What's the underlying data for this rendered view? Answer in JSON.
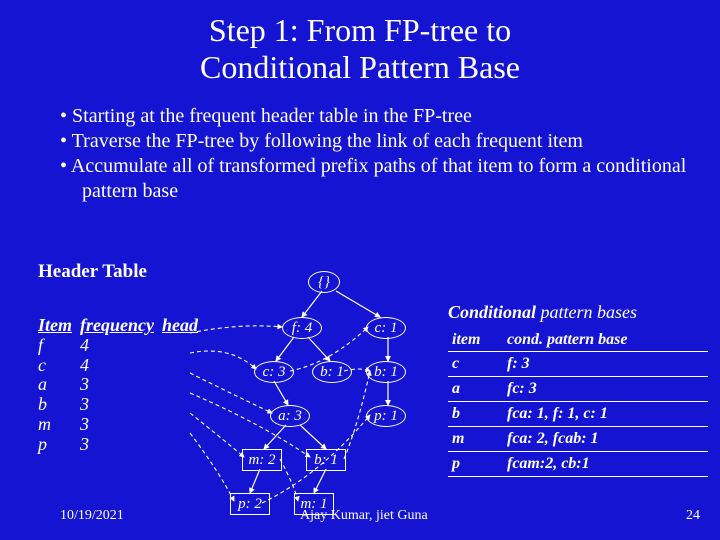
{
  "title_line1": "Step 1: From FP-tree to",
  "title_line2": "Conditional Pattern Base",
  "bullets": [
    "Starting at the frequent header table in the FP-tree",
    "Traverse the FP-tree by following the link of each frequent item",
    "Accumulate all of transformed prefix paths of that item to form a conditional pattern base"
  ],
  "header_table_label": "Header Table",
  "header_table": {
    "columns": [
      "Item",
      "frequency",
      "head"
    ],
    "rows": [
      {
        "item": "f",
        "freq": "4"
      },
      {
        "item": "c",
        "freq": "4"
      },
      {
        "item": "a",
        "freq": "3"
      },
      {
        "item": "b",
        "freq": "3"
      },
      {
        "item": "m",
        "freq": "3"
      },
      {
        "item": "p",
        "freq": "3"
      }
    ]
  },
  "tree_nodes": {
    "root": "{}",
    "f4": "f: 4",
    "c1": "c: 1",
    "c3": "c: 3",
    "b1a": "b: 1",
    "b1b": "b: 1",
    "a3": "a: 3",
    "p1": "p: 1",
    "m2": "m: 2",
    "b1c": "b: 1",
    "p2": "p: 2",
    "m1": "m: 1"
  },
  "cond_title_bold": "Conditional",
  "cond_title_rest": " pattern bases",
  "cond_table": {
    "col1": "item",
    "col2": "cond. pattern base",
    "rows": [
      {
        "item": "c",
        "base": "f: 3"
      },
      {
        "item": "a",
        "base": "fc: 3"
      },
      {
        "item": "b",
        "base": "fca: 1, f: 1, c: 1"
      },
      {
        "item": "m",
        "base": "fca: 2, fcab: 1"
      },
      {
        "item": "p",
        "base": "fcam:2, cb:1"
      }
    ]
  },
  "footer": {
    "date": "10/19/2021",
    "author": "Ajay Kumar, jiet Guna",
    "page": "24"
  }
}
